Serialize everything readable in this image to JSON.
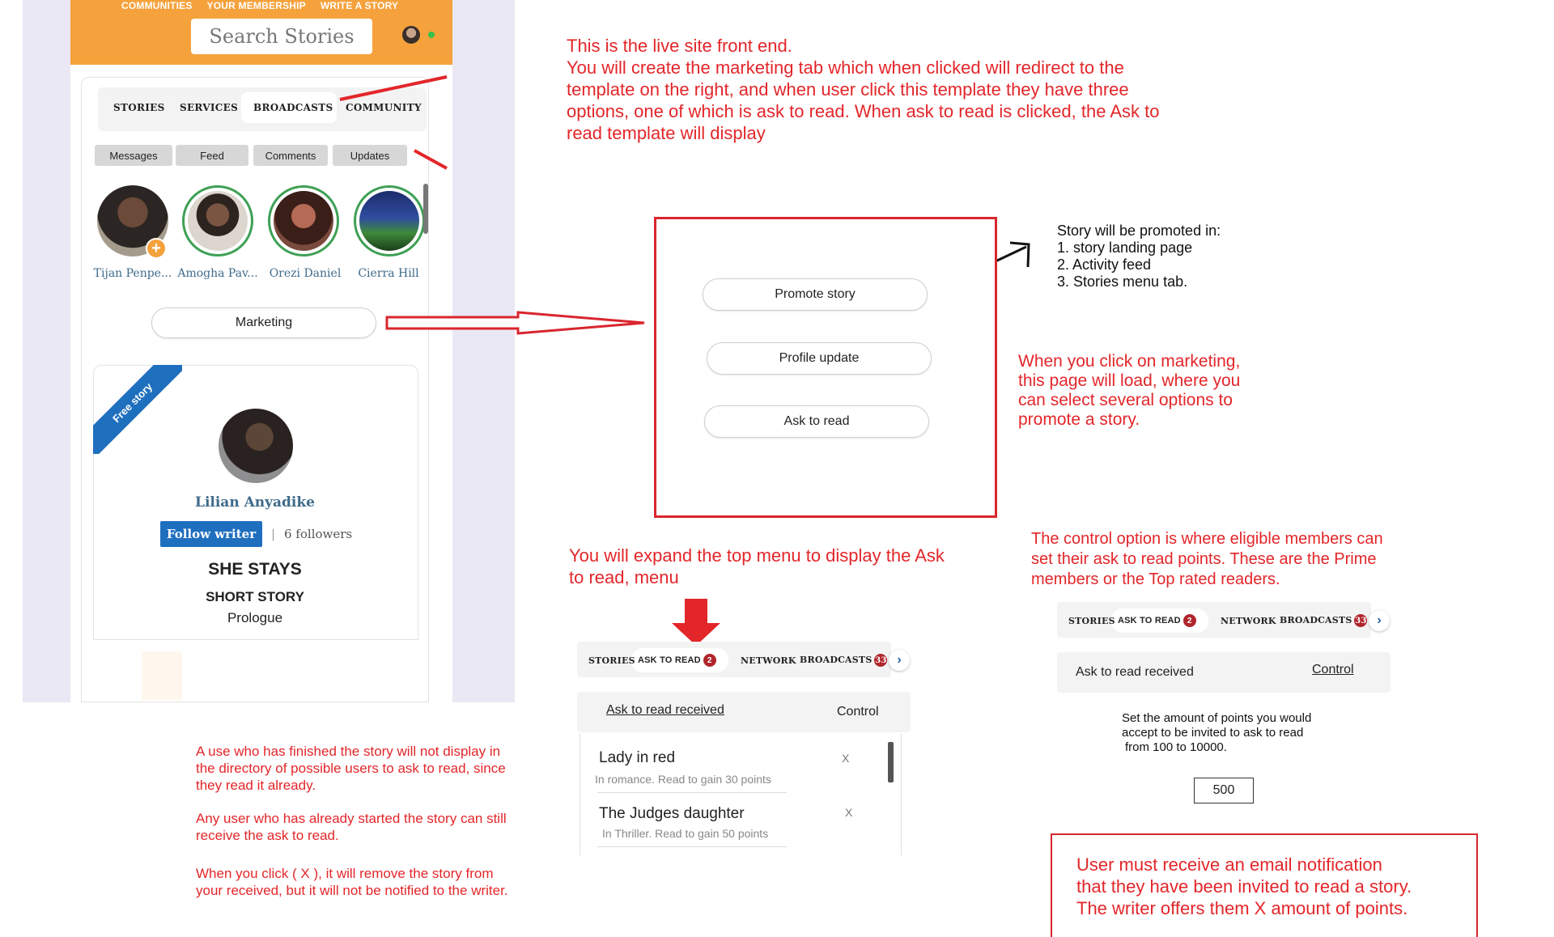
{
  "live_site": {
    "top_nav": [
      "COMMUNITIES",
      "YOUR MEMBERSHIP",
      "WRITE A STORY"
    ],
    "search_placeholder": "Search Stories",
    "main_tabs": [
      "STORIES",
      "SERVICES",
      "BROADCASTS",
      "COMMUNITY"
    ],
    "sub_tabs": [
      "Messages",
      "Feed",
      "Comments",
      "Updates"
    ],
    "story_users": [
      "Tijan Penpe...",
      "Amogha Pav...",
      "Orezi Daniel",
      "Cierra Hill"
    ],
    "marketing_button": "Marketing",
    "story_card": {
      "ribbon": "Free story",
      "author": "Lilian Anyadike",
      "follow_button": "Follow writer",
      "separator": "|",
      "followers": "6 followers",
      "title": "SHE STAYS",
      "type": "SHORT STORY",
      "chapter": "Prologue"
    }
  },
  "marketing_template": {
    "buttons": [
      "Promote story",
      "Profile update",
      "Ask to read"
    ]
  },
  "notes": {
    "live_site": [
      "This is the live site front end.",
      "You will create the marketing tab which when clicked will redirect to the",
      "template on the right, and when user click this template they have three",
      "options, one of which is ask to read. When ask to read is clicked, the Ask to",
      "read template will display"
    ],
    "promoted_in": [
      "Story will be promoted in:",
      "1. story landing page",
      "2. Activity feed",
      "3. Stories menu tab."
    ],
    "marketing_click": [
      "When you click on marketing,",
      "this page will load, where you",
      "can select several options to",
      "promote a story."
    ],
    "expand_menu": [
      "You will expand the top menu to display the Ask",
      "to read, menu"
    ],
    "control_option": [
      "The control option is where eligible members can",
      "set their ask to read points. These are the Prime",
      "members or the Top rated readers."
    ],
    "finished_story": [
      "A use who has finished the story will not display in",
      "the directory of possible users to ask to read, since",
      "they read it already."
    ],
    "started_story": [
      "Any user who has already started the story can still",
      "receive the ask to read."
    ],
    "remove_story": [
      "When you click ( X ), it will remove the story from",
      "your received, but it will not be notified to the writer."
    ],
    "email_notification": [
      "User must receive an email notification",
      "that they have been invited to read a story.",
      "The writer offers them X amount of points."
    ]
  },
  "ask_menu": {
    "tabs": [
      "STORIES",
      "ASK TO READ",
      "NETWORK",
      "BROADCASTS"
    ],
    "ask_badge": "2",
    "broadcast_badge": "33",
    "chevron": "›",
    "received_label": "Ask to read received",
    "control_label": "Control"
  },
  "ask_list": [
    {
      "title": "Lady in red",
      "subtitle": "In romance. Read to gain 30 points",
      "remove": "X"
    },
    {
      "title": "The Judges daughter",
      "subtitle": "In Thriller. Read to gain 50 points",
      "remove": "X"
    }
  ],
  "control_panel": {
    "instructions": [
      "Set the amount of points you would",
      "accept to be invited to ask to read",
      "from 100 to 10000."
    ],
    "points_value": "500"
  },
  "colors": {
    "header_orange": "#f5a23c",
    "annotation_red": "#e3262a",
    "follow_blue": "#1f6fbf",
    "badge_red": "#b0262c",
    "online_green": "#34c14b"
  }
}
